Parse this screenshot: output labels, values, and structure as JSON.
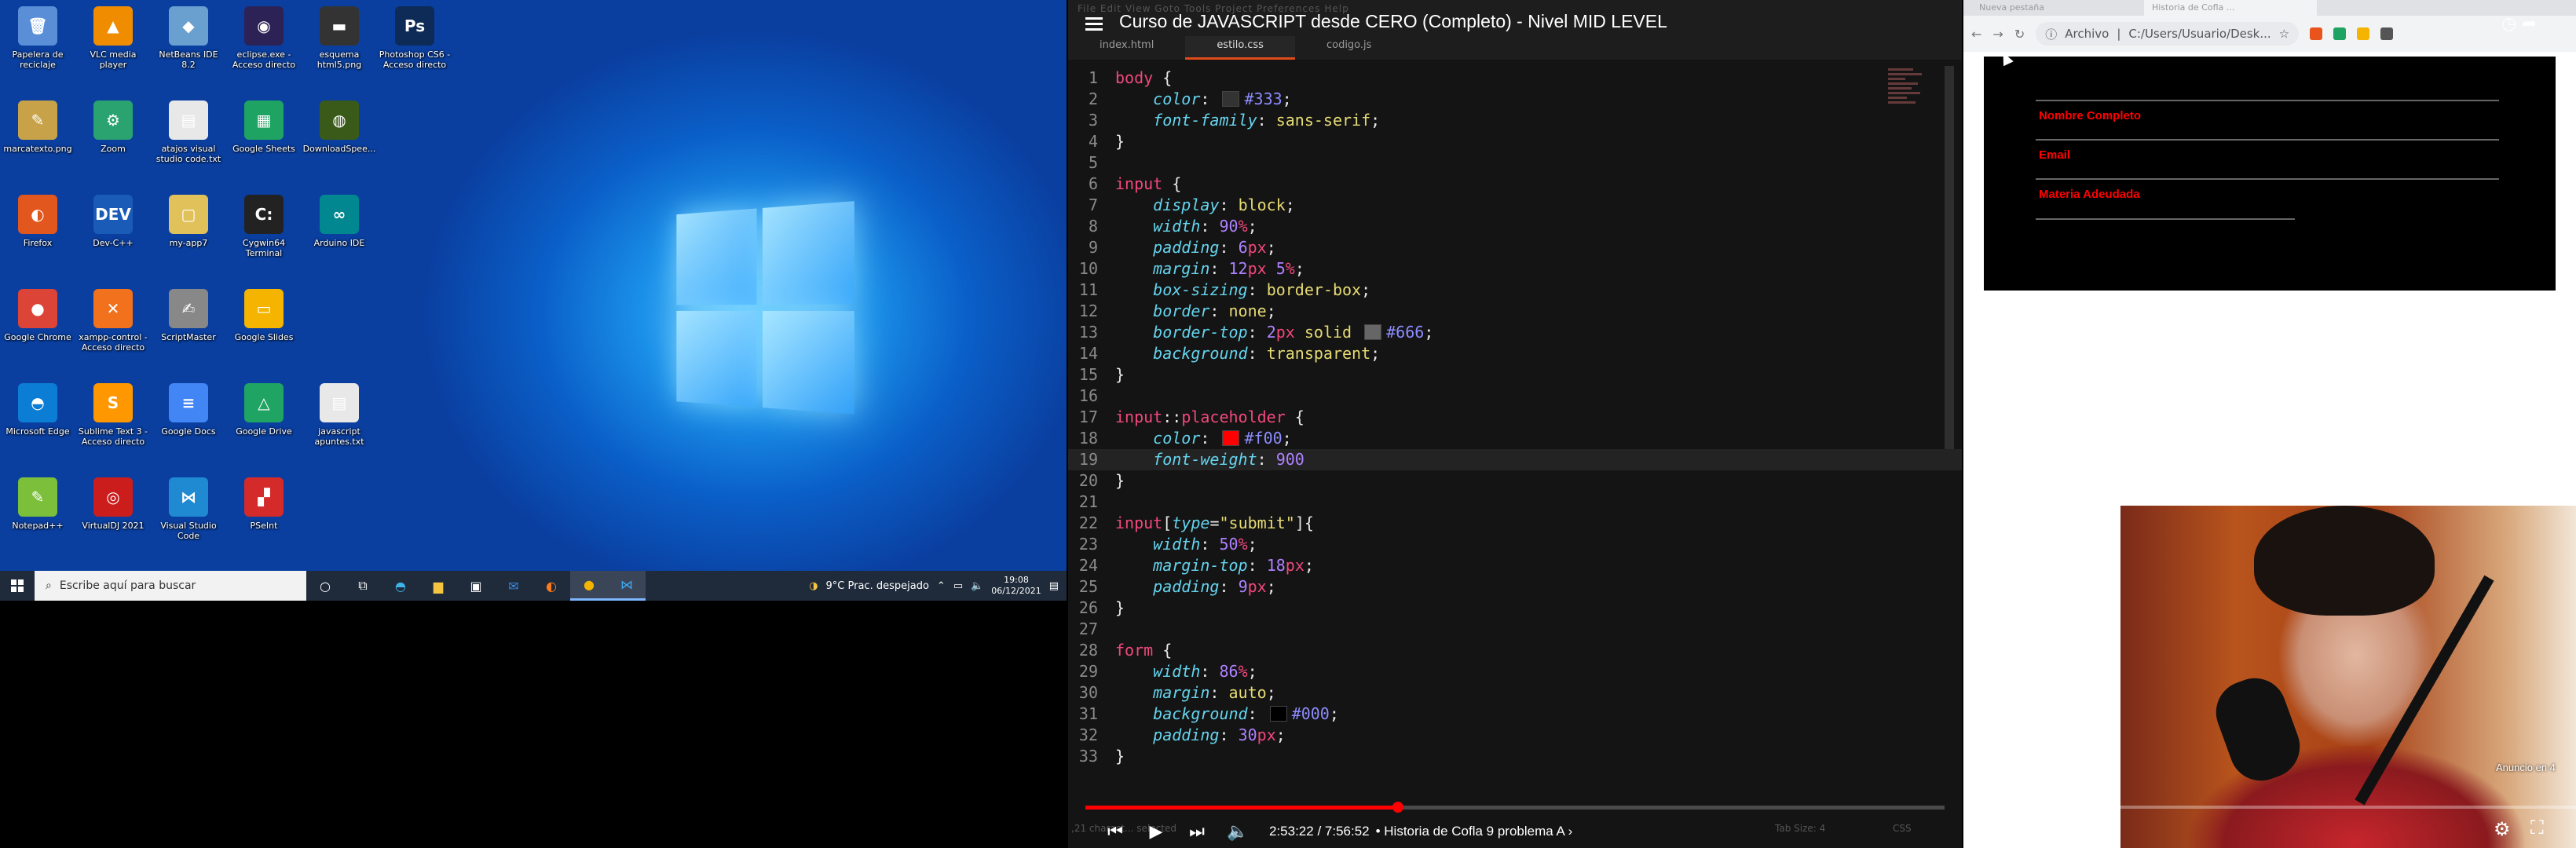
{
  "desktop": {
    "icons": [
      {
        "label": "Papelera de reciclaje",
        "glyph": "🗑",
        "color": "#5a8fd8",
        "col": 0,
        "row": 0
      },
      {
        "label": "VLC media player",
        "glyph": "▲",
        "color": "#f08c00",
        "col": 1,
        "row": 0
      },
      {
        "label": "NetBeans IDE 8.2",
        "glyph": "◆",
        "color": "#6aa0d0",
        "col": 2,
        "row": 0
      },
      {
        "label": "eclipse.exe - Acceso directo",
        "glyph": "◉",
        "color": "#2c2255",
        "col": 3,
        "row": 0
      },
      {
        "label": "esquema html5.png",
        "glyph": "▬",
        "color": "#333",
        "col": 4,
        "row": 0
      },
      {
        "label": "Photoshop CS6 - Acceso directo",
        "glyph": "Ps",
        "color": "#0e2a56",
        "col": 5,
        "row": 0
      },
      {
        "label": "marcatexto.png",
        "glyph": "✎",
        "color": "#c7a248",
        "col": 0,
        "row": 1
      },
      {
        "label": "Zoom",
        "glyph": "⚙",
        "color": "#2aa370",
        "col": 1,
        "row": 1
      },
      {
        "label": "atajos visual studio code.txt",
        "glyph": "▤",
        "color": "#e8e8e8",
        "col": 2,
        "row": 1
      },
      {
        "label": "Google Sheets",
        "glyph": "▦",
        "color": "#1ea362",
        "col": 3,
        "row": 1
      },
      {
        "label": "DownloadSpee...",
        "glyph": "◍",
        "color": "#3a5a1a",
        "col": 4,
        "row": 1
      },
      {
        "label": "Firefox",
        "glyph": "◐",
        "color": "#e2571e",
        "col": 0,
        "row": 2
      },
      {
        "label": "Dev-C++",
        "glyph": "DEV",
        "color": "#1a5bb8",
        "col": 1,
        "row": 2
      },
      {
        "label": "my-app7",
        "glyph": "▢",
        "color": "#e0c15a",
        "col": 2,
        "row": 2
      },
      {
        "label": "Cygwin64 Terminal",
        "glyph": "C:",
        "color": "#222",
        "col": 3,
        "row": 2
      },
      {
        "label": "Arduino IDE",
        "glyph": "∞",
        "color": "#00878f",
        "col": 4,
        "row": 2
      },
      {
        "label": "Google Chrome",
        "glyph": "●",
        "color": "#db4437",
        "col": 0,
        "row": 3
      },
      {
        "label": "xampp-control - Acceso directo",
        "glyph": "✕",
        "color": "#f2711c",
        "col": 1,
        "row": 3
      },
      {
        "label": "ScriptMaster",
        "glyph": "✍",
        "color": "#888",
        "col": 2,
        "row": 3
      },
      {
        "label": "Google Slides",
        "glyph": "▭",
        "color": "#f4b400",
        "col": 3,
        "row": 3
      },
      {
        "label": "Microsoft Edge",
        "glyph": "◓",
        "color": "#0c7dd4",
        "col": 0,
        "row": 4
      },
      {
        "label": "Sublime Text 3 - Acceso directo",
        "glyph": "S",
        "color": "#ff9800",
        "col": 1,
        "row": 4
      },
      {
        "label": "Google Docs",
        "glyph": "≡",
        "color": "#4285f4",
        "col": 2,
        "row": 4
      },
      {
        "label": "Google Drive",
        "glyph": "△",
        "color": "#1fa463",
        "col": 3,
        "row": 4
      },
      {
        "label": "javascript apuntes.txt",
        "glyph": "▤",
        "color": "#e8e8e8",
        "col": 4,
        "row": 4
      },
      {
        "label": "Notepad++",
        "glyph": "✎",
        "color": "#7cbf3b",
        "col": 0,
        "row": 5
      },
      {
        "label": "VirtualDJ 2021",
        "glyph": "◎",
        "color": "#cc1d1d",
        "col": 1,
        "row": 5
      },
      {
        "label": "Visual Studio Code",
        "glyph": "⋈",
        "color": "#1f8ad2",
        "col": 2,
        "row": 5
      },
      {
        "label": "PSeInt",
        "glyph": "▞",
        "color": "#d42a2a",
        "col": 3,
        "row": 5
      }
    ],
    "taskbar": {
      "search_placeholder": "Escribe aquí para buscar",
      "weather": "9°C  Prac. despejado",
      "time": "19:08",
      "date": "06/12/2021"
    }
  },
  "video": {
    "title": "Curso de JAVASCRIPT desde CERO (Completo) - Nivel MID LEVEL",
    "faint_menu": "File   Edit   View   Goto   Tools   Project   Preferences   Help",
    "tabs": [
      "index.html",
      "estilo.css",
      "codigo.js"
    ],
    "active_tab": 1,
    "current_line": 19,
    "time": "2:53:22 / 7:56:52",
    "chapter": "• Historia de Cofla 9 problema A ›",
    "progress_fraction": 0.3637,
    "status_left": ",21 charact... selected",
    "status_tab": "Tab Size: 4",
    "status_lang": "CSS"
  },
  "code_lines": [
    {
      "n": 1,
      "html": "<span class='sel'>body</span> {"
    },
    {
      "n": 2,
      "html": "    <span class='prop'>color</span>: <span class='swatch' style='background:#333'></span><span class='hex'>#333</span>;"
    },
    {
      "n": 3,
      "html": "    <span class='prop'>font-family</span>: <span class='val'>sans-serif</span>;"
    },
    {
      "n": 4,
      "html": "}"
    },
    {
      "n": 5,
      "html": ""
    },
    {
      "n": 6,
      "html": "<span class='sel'>input</span> {"
    },
    {
      "n": 7,
      "html": "    <span class='prop'>display</span>: <span class='val'>block</span>;"
    },
    {
      "n": 8,
      "html": "    <span class='prop'>width</span>: <span class='num'>90</span><span class='unit'>%</span>;"
    },
    {
      "n": 9,
      "html": "    <span class='prop'>padding</span>: <span class='num'>6</span><span class='unit'>px</span>;"
    },
    {
      "n": 10,
      "html": "    <span class='prop'>margin</span>: <span class='num'>12</span><span class='unit'>px</span> <span class='num'>5</span><span class='unit'>%</span>;"
    },
    {
      "n": 11,
      "html": "    <span class='prop'>box-sizing</span>: <span class='val'>border-box</span>;"
    },
    {
      "n": 12,
      "html": "    <span class='prop'>border</span>: <span class='val'>none</span>;"
    },
    {
      "n": 13,
      "html": "    <span class='prop'>border-top</span>: <span class='num'>2</span><span class='unit'>px</span> <span class='val'>solid</span> <span class='swatch' style='background:#666'></span><span class='hex'>#666</span>;"
    },
    {
      "n": 14,
      "html": "    <span class='prop'>background</span>: <span class='val'>transparent</span>;"
    },
    {
      "n": 15,
      "html": "}"
    },
    {
      "n": 16,
      "html": ""
    },
    {
      "n": 17,
      "html": "<span class='sel'>input</span>::<span class='sel'>placeholder</span> {"
    },
    {
      "n": 18,
      "html": "    <span class='prop'>color</span>: <span class='swatch' style='background:#f00'></span><span class='hex'>#f00</span>;"
    },
    {
      "n": 19,
      "html": "    <span class='prop'>font-weight</span>: <span class='num'>900</span>"
    },
    {
      "n": 20,
      "html": "}"
    },
    {
      "n": 21,
      "html": ""
    },
    {
      "n": 22,
      "html": "<span class='sel'>input</span>[<span class='prop'>type</span>=<span class='str'>\"submit\"</span>]{"
    },
    {
      "n": 23,
      "html": "    <span class='prop'>width</span>: <span class='num'>50</span><span class='unit'>%</span>;"
    },
    {
      "n": 24,
      "html": "    <span class='prop'>margin-top</span>: <span class='num'>18</span><span class='unit'>px</span>;"
    },
    {
      "n": 25,
      "html": "    <span class='prop'>padding</span>: <span class='num'>9</span><span class='unit'>px</span>;"
    },
    {
      "n": 26,
      "html": "}"
    },
    {
      "n": 27,
      "html": ""
    },
    {
      "n": 28,
      "html": "<span class='sel'>form</span> {"
    },
    {
      "n": 29,
      "html": "    <span class='prop'>width</span>: <span class='num'>86</span><span class='unit'>%</span>;"
    },
    {
      "n": 30,
      "html": "    <span class='prop'>margin</span>: <span class='val'>auto</span>;"
    },
    {
      "n": 31,
      "html": "    <span class='prop'>background</span>: <span class='swatch' style='background:#000'></span><span class='hex'>#000</span>;"
    },
    {
      "n": 32,
      "html": "    <span class='prop'>padding</span>: <span class='num'>30</span><span class='unit'>px</span>;"
    },
    {
      "n": 33,
      "html": "}"
    }
  ],
  "browser": {
    "tabs": [
      "Nueva pestaña",
      "Historia de Cofla ..."
    ],
    "address_label": "Archivo",
    "address": "C:/Users/Usuario/Desk...",
    "form_fields": [
      "Nombre Completo",
      "Email",
      "Materia Adeudada"
    ],
    "ad_label": "Anuncio en 4"
  }
}
